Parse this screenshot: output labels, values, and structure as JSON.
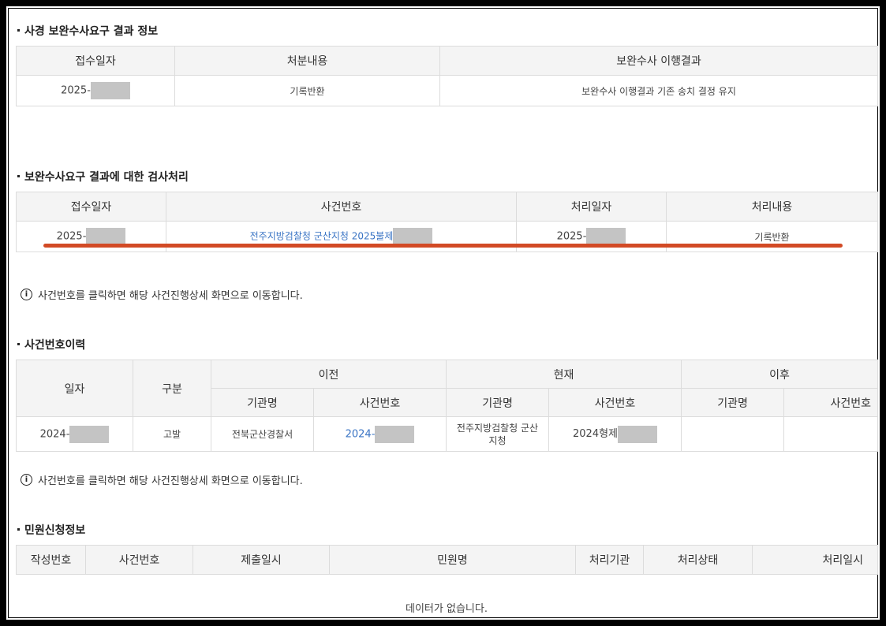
{
  "section1": {
    "title": "사경 보완수사요구 결과 정보",
    "headers": [
      "접수일자",
      "처분내용",
      "보완수사 이행결과"
    ],
    "row": {
      "date_prefix": "2025-",
      "disposition": "기록반환",
      "result": "보완수사 이행결과 기존 송치 결정 유지"
    }
  },
  "section2": {
    "title": "보완수사요구 결과에 대한 검사처리",
    "headers": [
      "접수일자",
      "사건번호",
      "처리일자",
      "처리내용"
    ],
    "row": {
      "date_prefix": "2025-",
      "case_no_prefix": "전주지방검찰청 군산지청 2025불제",
      "proc_date_prefix": "2025-",
      "proc_content": "기록반환"
    }
  },
  "notice1": "사건번호를 클릭하면 해당 사건진행상세 화면으로 이동합니다.",
  "section3": {
    "title": "사건번호이력",
    "group_headers": {
      "date": "일자",
      "type": "구분",
      "before": "이전",
      "current": "현재",
      "after": "이후"
    },
    "sub_headers": {
      "agency": "기관명",
      "case_no": "사건번호"
    },
    "row": {
      "date_prefix": "2024-",
      "type": "고발",
      "before_agency": "전북군산경찰서",
      "before_case_prefix": "2024-",
      "current_agency": "전주지방검찰청 군산지청",
      "current_case_prefix": "2024형제",
      "after_agency": "",
      "after_case": ""
    }
  },
  "notice2": "사건번호를 클릭하면 해당 사건진행상세 화면으로 이동합니다.",
  "section4": {
    "title": "민원신청정보",
    "headers": [
      "작성번호",
      "사건번호",
      "제출일시",
      "민원명",
      "처리기관",
      "처리상태",
      "처리일시"
    ],
    "empty": "데이터가 없습니다."
  },
  "colors": {
    "link": "#3a74c4",
    "highlight": "#d24a25",
    "header_bg": "#f4f4f4"
  }
}
